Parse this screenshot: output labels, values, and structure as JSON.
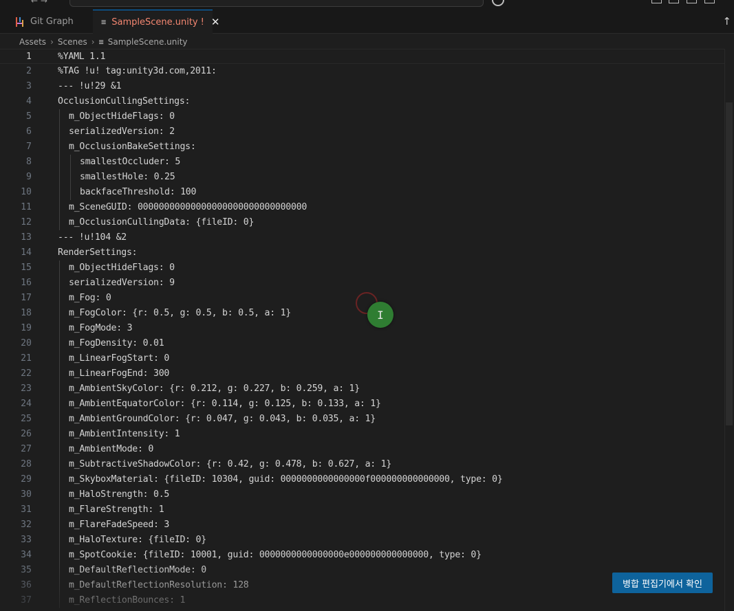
{
  "tabs": [
    {
      "label": "Git Graph",
      "icon": "git-graph-icon"
    },
    {
      "label": "SampleScene.unity",
      "modified": "!",
      "icon": "file-lines-icon",
      "active": true
    }
  ],
  "breadcrumb": [
    "Assets",
    "Scenes",
    "SampleScene.unity"
  ],
  "editor": {
    "current_line": 1,
    "lines": [
      {
        "n": "1",
        "indent": 0,
        "text": "%YAML 1.1"
      },
      {
        "n": "2",
        "indent": 0,
        "text": "%TAG !u! tag:unity3d.com,2011:"
      },
      {
        "n": "3",
        "indent": 0,
        "text": "--- !u!29 &1"
      },
      {
        "n": "4",
        "indent": 0,
        "text": "OcclusionCullingSettings:"
      },
      {
        "n": "5",
        "indent": 1,
        "text": "m_ObjectHideFlags: 0"
      },
      {
        "n": "6",
        "indent": 1,
        "text": "serializedVersion: 2"
      },
      {
        "n": "7",
        "indent": 1,
        "text": "m_OcclusionBakeSettings:"
      },
      {
        "n": "8",
        "indent": 2,
        "text": "smallestOccluder: 5"
      },
      {
        "n": "9",
        "indent": 2,
        "text": "smallestHole: 0.25"
      },
      {
        "n": "10",
        "indent": 2,
        "text": "backfaceThreshold: 100"
      },
      {
        "n": "11",
        "indent": 1,
        "text": "m_SceneGUID: 00000000000000000000000000000000"
      },
      {
        "n": "12",
        "indent": 1,
        "text": "m_OcclusionCullingData: {fileID: 0}"
      },
      {
        "n": "13",
        "indent": 0,
        "text": "--- !u!104 &2"
      },
      {
        "n": "14",
        "indent": 0,
        "text": "RenderSettings:"
      },
      {
        "n": "15",
        "indent": 1,
        "text": "m_ObjectHideFlags: 0"
      },
      {
        "n": "16",
        "indent": 1,
        "text": "serializedVersion: 9"
      },
      {
        "n": "17",
        "indent": 1,
        "text": "m_Fog: 0"
      },
      {
        "n": "18",
        "indent": 1,
        "text": "m_FogColor: {r: 0.5, g: 0.5, b: 0.5, a: 1}"
      },
      {
        "n": "19",
        "indent": 1,
        "text": "m_FogMode: 3"
      },
      {
        "n": "20",
        "indent": 1,
        "text": "m_FogDensity: 0.01"
      },
      {
        "n": "21",
        "indent": 1,
        "text": "m_LinearFogStart: 0"
      },
      {
        "n": "22",
        "indent": 1,
        "text": "m_LinearFogEnd: 300"
      },
      {
        "n": "23",
        "indent": 1,
        "text": "m_AmbientSkyColor: {r: 0.212, g: 0.227, b: 0.259, a: 1}"
      },
      {
        "n": "24",
        "indent": 1,
        "text": "m_AmbientEquatorColor: {r: 0.114, g: 0.125, b: 0.133, a: 1}"
      },
      {
        "n": "25",
        "indent": 1,
        "text": "m_AmbientGroundColor: {r: 0.047, g: 0.043, b: 0.035, a: 1}"
      },
      {
        "n": "26",
        "indent": 1,
        "text": "m_AmbientIntensity: 1"
      },
      {
        "n": "27",
        "indent": 1,
        "text": "m_AmbientMode: 0"
      },
      {
        "n": "28",
        "indent": 1,
        "text": "m_SubtractiveShadowColor: {r: 0.42, g: 0.478, b: 0.627, a: 1}"
      },
      {
        "n": "29",
        "indent": 1,
        "text": "m_SkyboxMaterial: {fileID: 10304, guid: 0000000000000000f000000000000000, type: 0}"
      },
      {
        "n": "30",
        "indent": 1,
        "text": "m_HaloStrength: 0.5"
      },
      {
        "n": "31",
        "indent": 1,
        "text": "m_FlareStrength: 1"
      },
      {
        "n": "32",
        "indent": 1,
        "text": "m_FlareFadeSpeed: 3"
      },
      {
        "n": "33",
        "indent": 1,
        "text": "m_HaloTexture: {fileID: 0}"
      },
      {
        "n": "34",
        "indent": 1,
        "text": "m_SpotCookie: {fileID: 10001, guid: 0000000000000000e000000000000000, type: 0}"
      },
      {
        "n": "35",
        "indent": 1,
        "text": "m_DefaultReflectionMode: 0"
      },
      {
        "n": "36",
        "indent": 1,
        "text": "m_DefaultReflectionResolution: 128"
      },
      {
        "n": "37",
        "indent": 1,
        "text": "m_ReflectionBounces: 1"
      }
    ]
  },
  "merge_button": {
    "label": "병합 편집기에서 확인"
  },
  "colors": {
    "background": "#1e1e1e",
    "modified_tab": "#f48771",
    "button": "#0e639c",
    "cursor_indicator": "#2f7d32"
  }
}
